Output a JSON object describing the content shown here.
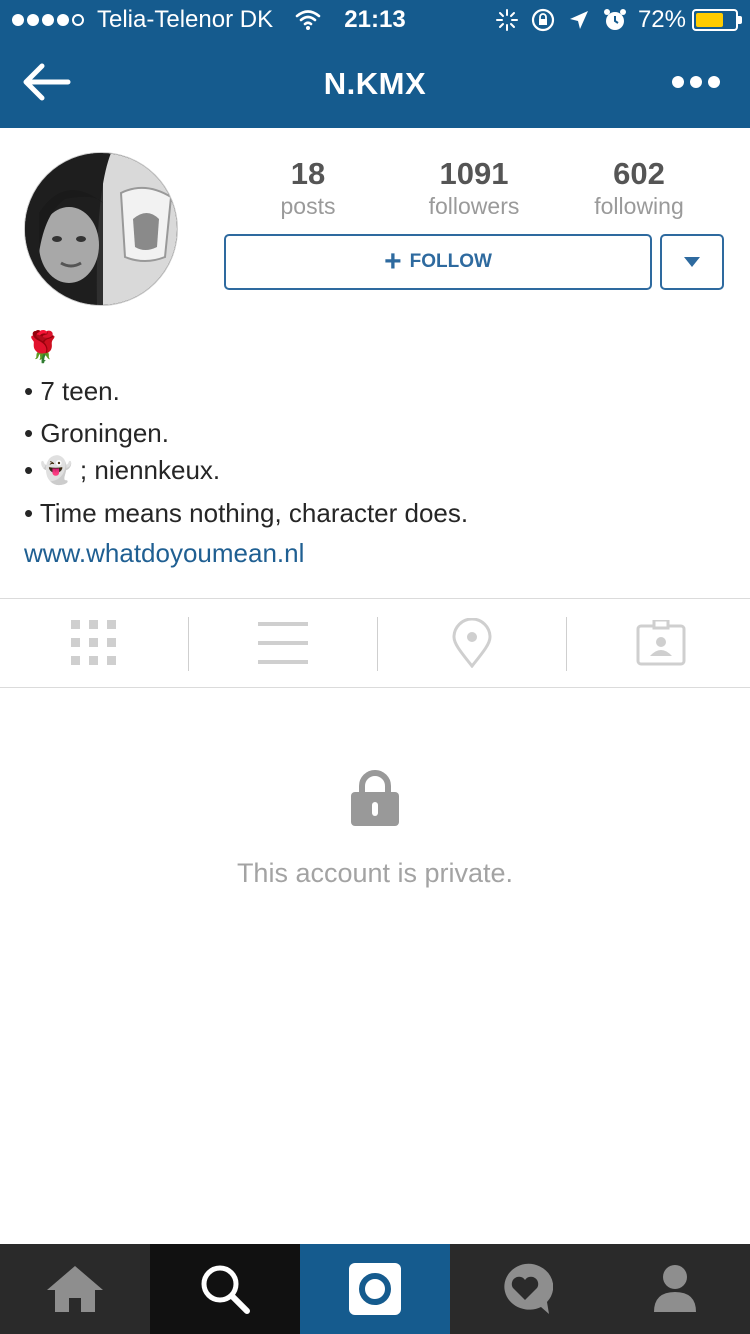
{
  "status_bar": {
    "carrier": "Telia-Telenor DK",
    "time": "21:13",
    "battery_percent": "72%",
    "battery_level": 0.72,
    "signal_bars_filled": 4,
    "signal_bars_total": 5,
    "icons": [
      "wifi-icon",
      "activity-icon",
      "rotation-lock-icon",
      "location-arrow-icon",
      "alarm-icon"
    ]
  },
  "nav": {
    "title": "N.KMX",
    "back_icon": "back-arrow-icon",
    "more_icon": "more-dots-icon"
  },
  "colors": {
    "header": "#155b8e",
    "accent": "#2e6a9f",
    "link": "#1f5f92",
    "battery_fill": "#ffcc00",
    "tabbar": "#2a2a2a",
    "tabbar_active": "#155b8e"
  },
  "profile": {
    "stats": [
      {
        "value": "18",
        "label": "posts"
      },
      {
        "value": "1091",
        "label": "followers"
      },
      {
        "value": "602",
        "label": "following"
      }
    ],
    "follow_label": "FOLLOW",
    "dropdown_icon": "caret-down-icon"
  },
  "bio": {
    "emoji_line": "🌹",
    "bullets": [
      "• 7 teen.",
      "• Groningen.",
      "• 👻 ; niennkeux.",
      "• Time means nothing, character does."
    ],
    "website": "www.whatdoyoumean.nl"
  },
  "view_tabs": [
    "grid-icon",
    "list-icon",
    "location-pin-icon",
    "tagged-photos-icon"
  ],
  "private": {
    "icon": "lock-icon",
    "message": "This account is private."
  },
  "tabbar": {
    "items": [
      "home-icon",
      "search-icon",
      "camera-icon",
      "activity-heart-icon",
      "profile-icon"
    ],
    "active_index": 2
  }
}
